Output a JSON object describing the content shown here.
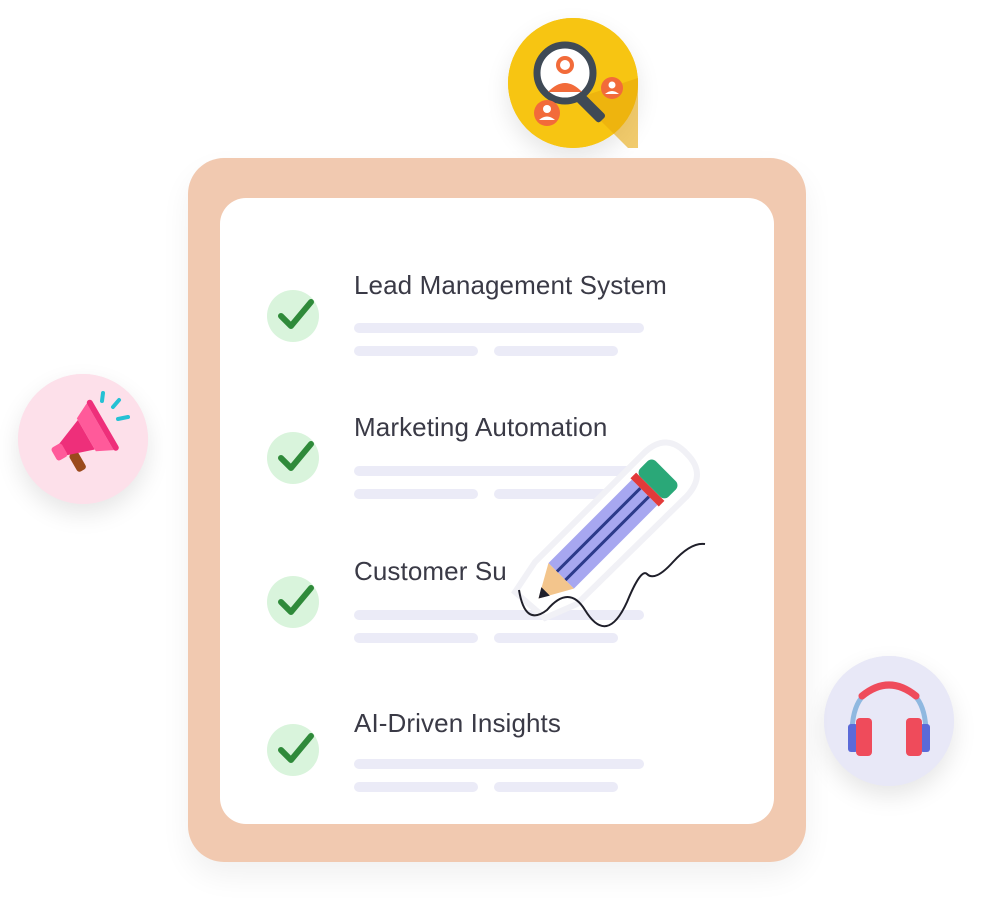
{
  "checklist": {
    "items": [
      {
        "label": "Lead Management System",
        "checked": true
      },
      {
        "label": "Marketing Automation",
        "checked": true
      },
      {
        "label": "Customer Su",
        "checked": true
      },
      {
        "label": "AI-Driven Insights",
        "checked": true
      }
    ]
  },
  "icons": {
    "top": "user-search-icon",
    "left": "megaphone-icon",
    "right": "headphones-icon",
    "overlay": "pencil-icon",
    "check": "checkmark-icon"
  },
  "colors": {
    "clipboard": "#f1c9b0",
    "paper": "#ffffff",
    "check_bg": "#d9f4dc",
    "check_mark": "#2f8a3a",
    "placeholder_line": "#ebebf7",
    "title_text": "#3a3a46",
    "top_bubble": "#f7c512",
    "left_bubble": "#fde0ea",
    "right_bubble": "#e8e8f7"
  }
}
